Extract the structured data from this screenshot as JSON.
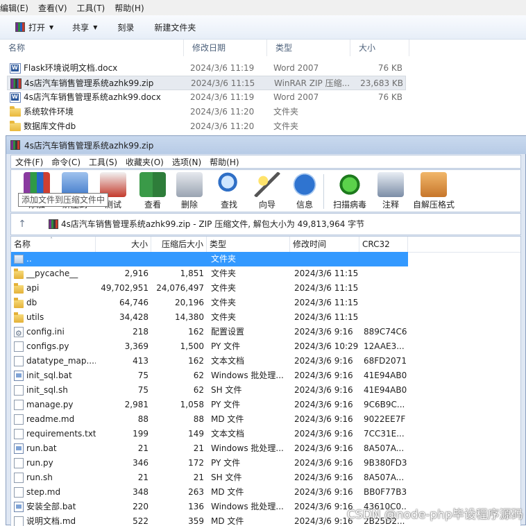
{
  "explorer": {
    "menu": [
      "编辑(E)",
      "查看(V)",
      "工具(T)",
      "帮助(H)"
    ],
    "toolbar": {
      "open": "打开",
      "share": "共享",
      "burn": "刻录",
      "new_folder": "新建文件夹"
    },
    "columns": {
      "name": "名称",
      "modified": "修改日期",
      "type": "类型",
      "size": "大小"
    },
    "files": [
      {
        "name": "Flask环境说明文档.docx",
        "modified": "2024/3/6 11:19",
        "type": "Word 2007",
        "size": "76 KB",
        "icon": "docx-icon"
      },
      {
        "name": "4s店汽车销售管理系统azhk99.zip",
        "modified": "2024/3/6 11:15",
        "type": "WinRAR ZIP 压缩...",
        "size": "23,683 KB",
        "icon": "zip-icon"
      },
      {
        "name": "4s店汽车销售管理系统azhk99.docx",
        "modified": "2024/3/6 11:19",
        "type": "Word 2007",
        "size": "76 KB",
        "icon": "docx-icon"
      },
      {
        "name": "系统软件环境",
        "modified": "2024/3/6 11:20",
        "type": "文件夹",
        "size": "",
        "icon": "folder-icon"
      },
      {
        "name": "数据库文件db",
        "modified": "2024/3/6 11:20",
        "type": "文件夹",
        "size": "",
        "icon": "folder-icon"
      }
    ]
  },
  "winrar": {
    "title": "4s店汽车销售管理系统azhk99.zip",
    "menu": [
      "文件(F)",
      "命令(C)",
      "工具(S)",
      "收藏夹(O)",
      "选项(N)",
      "帮助(H)"
    ],
    "tools": [
      {
        "label": "添加",
        "icon": "add-icon"
      },
      {
        "label": "解压到",
        "icon": "extract-icon"
      },
      {
        "label": "测试",
        "icon": "test-icon"
      },
      {
        "label": "查看",
        "icon": "view-icon"
      },
      {
        "label": "删除",
        "icon": "delete-icon"
      },
      {
        "label": "查找",
        "icon": "find-icon"
      },
      {
        "label": "向导",
        "icon": "wizard-icon"
      },
      {
        "label": "信息",
        "icon": "info-icon"
      },
      {
        "label": "扫描病毒",
        "icon": "virus-scan-icon"
      },
      {
        "label": "注释",
        "icon": "comment-icon"
      },
      {
        "label": "自解压格式",
        "icon": "sfx-icon"
      }
    ],
    "tooltip": "添加文件到压缩文件中",
    "path": "4s店汽车销售管理系统azhk99.zip - ZIP 压缩文件, 解包大小为 49,813,964 字节",
    "columns": {
      "name": "名称",
      "size": "大小",
      "packed": "压缩后大小",
      "type": "类型",
      "modified": "修改时间",
      "crc": "CRC32"
    },
    "rows": [
      {
        "name": "..",
        "size": "",
        "packed": "",
        "type": "文件夹",
        "modified": "",
        "crc": "",
        "icon": "up"
      },
      {
        "name": "__pycache__",
        "size": "2,916",
        "packed": "1,851",
        "type": "文件夹",
        "modified": "2024/3/6 11:15",
        "crc": "",
        "icon": "folder"
      },
      {
        "name": "api",
        "size": "49,702,951",
        "packed": "24,076,497",
        "type": "文件夹",
        "modified": "2024/3/6 11:15",
        "crc": "",
        "icon": "folder"
      },
      {
        "name": "db",
        "size": "64,746",
        "packed": "20,196",
        "type": "文件夹",
        "modified": "2024/3/6 11:15",
        "crc": "",
        "icon": "folder"
      },
      {
        "name": "utils",
        "size": "34,428",
        "packed": "14,380",
        "type": "文件夹",
        "modified": "2024/3/6 11:15",
        "crc": "",
        "icon": "folder"
      },
      {
        "name": "config.ini",
        "size": "218",
        "packed": "162",
        "type": "配置设置",
        "modified": "2024/3/6 9:16",
        "crc": "889C74C6",
        "icon": "cfg"
      },
      {
        "name": "configs.py",
        "size": "3,369",
        "packed": "1,500",
        "type": "PY 文件",
        "modified": "2024/3/6 10:29",
        "crc": "12AAE3...",
        "icon": "file"
      },
      {
        "name": "datatype_map....",
        "size": "413",
        "packed": "162",
        "type": "文本文档",
        "modified": "2024/3/6 9:16",
        "crc": "68FD2071",
        "icon": "file"
      },
      {
        "name": "init_sql.bat",
        "size": "75",
        "packed": "62",
        "type": "Windows 批处理...",
        "modified": "2024/3/6 9:16",
        "crc": "41E94AB0",
        "icon": "bat"
      },
      {
        "name": "init_sql.sh",
        "size": "75",
        "packed": "62",
        "type": "SH 文件",
        "modified": "2024/3/6 9:16",
        "crc": "41E94AB0",
        "icon": "file"
      },
      {
        "name": "manage.py",
        "size": "2,981",
        "packed": "1,058",
        "type": "PY 文件",
        "modified": "2024/3/6 9:16",
        "crc": "9C6B9C...",
        "icon": "file"
      },
      {
        "name": "readme.md",
        "size": "88",
        "packed": "88",
        "type": "MD 文件",
        "modified": "2024/3/6 9:16",
        "crc": "9022EE7F",
        "icon": "file"
      },
      {
        "name": "requirements.txt",
        "size": "199",
        "packed": "149",
        "type": "文本文档",
        "modified": "2024/3/6 9:16",
        "crc": "7CC31E...",
        "icon": "file"
      },
      {
        "name": "run.bat",
        "size": "21",
        "packed": "21",
        "type": "Windows 批处理...",
        "modified": "2024/3/6 9:16",
        "crc": "8A507A...",
        "icon": "bat"
      },
      {
        "name": "run.py",
        "size": "346",
        "packed": "172",
        "type": "PY 文件",
        "modified": "2024/3/6 9:16",
        "crc": "9B380FD3",
        "icon": "file"
      },
      {
        "name": "run.sh",
        "size": "21",
        "packed": "21",
        "type": "SH 文件",
        "modified": "2024/3/6 9:16",
        "crc": "8A507A...",
        "icon": "file"
      },
      {
        "name": "step.md",
        "size": "348",
        "packed": "263",
        "type": "MD 文件",
        "modified": "2024/3/6 9:16",
        "crc": "BB0F77B3",
        "icon": "file"
      },
      {
        "name": "安装全部.bat",
        "size": "220",
        "packed": "136",
        "type": "Windows 批处理...",
        "modified": "2024/3/6 9:16",
        "crc": "43610C0...",
        "icon": "bat"
      },
      {
        "name": "说明文档.md",
        "size": "522",
        "packed": "359",
        "type": "MD 文件",
        "modified": "2024/3/6 9:16",
        "crc": "2B25D2...",
        "icon": "file"
      }
    ]
  },
  "watermark": "CSDN @node-php毕设程序源码"
}
